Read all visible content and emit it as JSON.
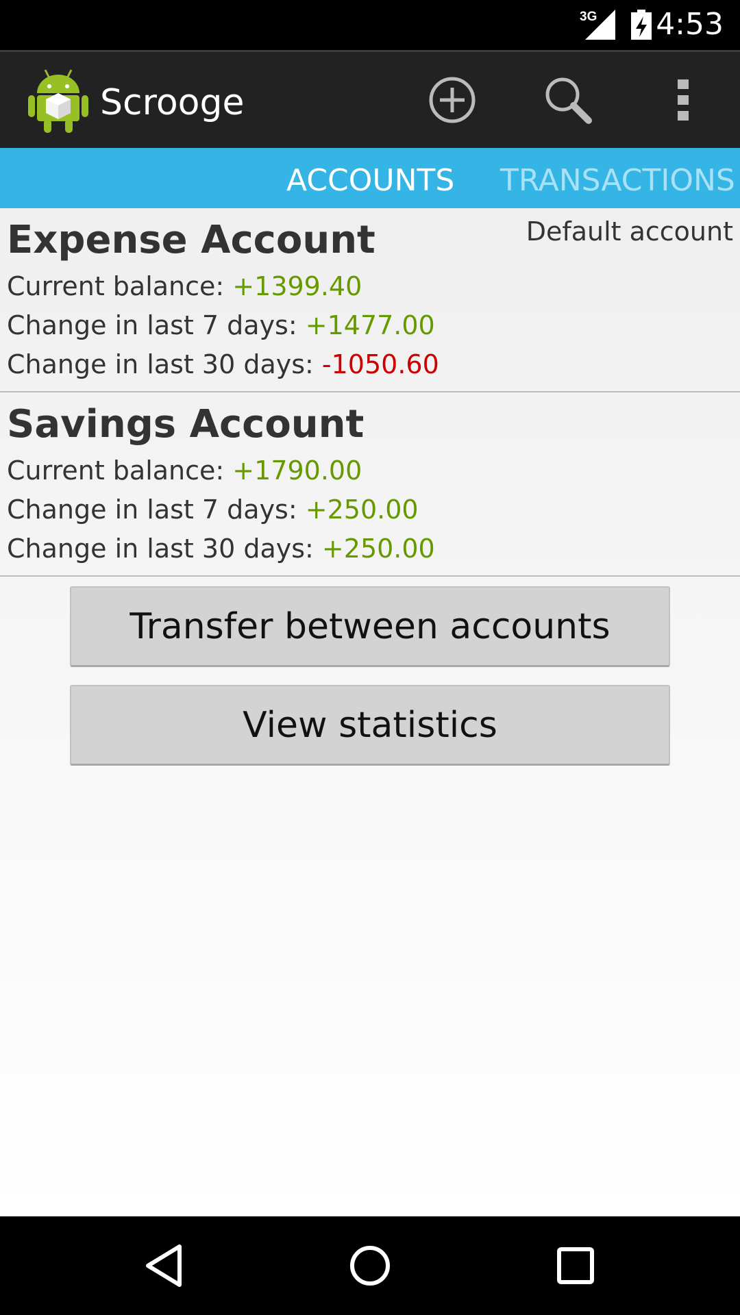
{
  "status_bar": {
    "network": "3G",
    "time": "4:53"
  },
  "action_bar": {
    "app_icon": "android-robot-icon",
    "title": "Scrooge",
    "actions": [
      "add-icon",
      "search-icon",
      "overflow-menu-icon"
    ]
  },
  "tabs": {
    "items": [
      {
        "label": "ACCOUNTS",
        "selected": true
      },
      {
        "label": "TRANSACTIONS",
        "selected": false
      }
    ]
  },
  "accounts": [
    {
      "name": "Expense Account",
      "badge": "Default account",
      "balance_label": "Current balance: ",
      "balance": "+1399.40",
      "week_label": "Change in last 7 days: ",
      "week": "+1477.00",
      "month_label": "Change in last 30 days: ",
      "month": "-1050.60"
    },
    {
      "name": "Savings Account",
      "badge": "",
      "balance_label": "Current balance: ",
      "balance": "+1790.00",
      "week_label": "Change in last 7 days: ",
      "week": "+250.00",
      "month_label": "Change in last 30 days: ",
      "month": "+250.00"
    }
  ],
  "buttons": {
    "transfer": "Transfer between accounts",
    "statistics": "View statistics"
  },
  "nav_bar": [
    "back-icon",
    "home-icon",
    "recents-icon"
  ],
  "colors": {
    "accent": "#34b5e5",
    "positive": "#669900",
    "negative": "#cc0000"
  }
}
